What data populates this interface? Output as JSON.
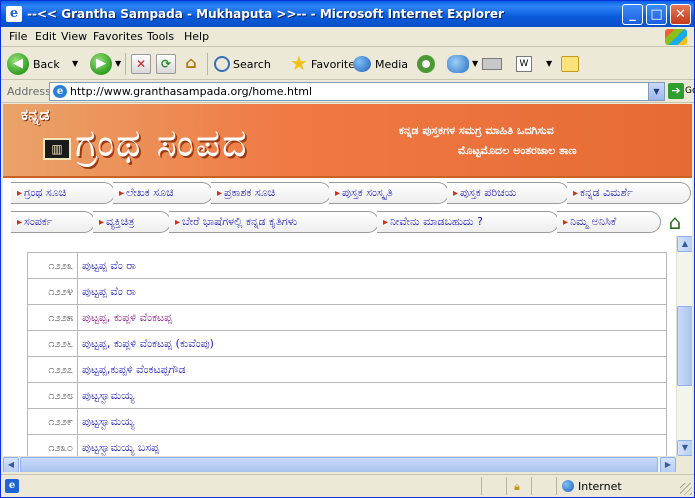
{
  "window": {
    "title": "--<< Grantha Sampada - Mukhaputa >>-- - Microsoft Internet Explorer",
    "min_glyph": "_",
    "max_glyph": "□",
    "close_glyph": "✕"
  },
  "menu": {
    "file": "File",
    "edit": "Edit",
    "view": "View",
    "favorites": "Favorites",
    "tools": "Tools",
    "help": "Help"
  },
  "toolbar": {
    "back": "Back",
    "search": "Search",
    "favorites": "Favorites",
    "media": "Media"
  },
  "address": {
    "label": "Address",
    "url": "http://www.granthasampada.org/home.html",
    "go": "Go"
  },
  "banner": {
    "kannada": "ಕನ್ನಡ",
    "title": "ಗ್ರಂಥ ಸಂಪದ",
    "subtitle_line1": "ಕನ್ನಡ ಪುಸ್ತಕಗಳ ಸಮಗ್ರ ಮಾಹಿತಿ ಒದಗಿಸುವ",
    "subtitle_line2": "ಮೊಟ್ಟಮೊದಲ ಅಂತರಜಾಲ ತಾಣ"
  },
  "nav": {
    "row1": [
      "ಗ್ರಂಥ ಸೂಚಿ",
      "ಲೇಖಕ ಸೂಚಿ",
      "ಪ್ರಕಾಶಕ ಸೂಚಿ",
      "ಪುಸ್ತಕ ಸಂಸ್ಕೃತಿ",
      "ಪುಸ್ತಕ ಪರಿಚಯ",
      "ಕನ್ನಡ ವಿಮರ್ಶೆ"
    ],
    "row2": [
      "ಸಂಪರ್ಕ",
      "ವ್ಯಕ್ತಿಚಿತ್ರ",
      "ಬೇರೆ ಭಾಷೆಗಳಲ್ಲಿ ಕನ್ನಡ ಕೃತಿಗಳು",
      "ನೀವೇನು ಮಾಡಬಹುದು ?",
      "ನಿಮ್ಮ ಅನಿಸಿಕೆ"
    ]
  },
  "table": {
    "rows": [
      {
        "num": "೧೨೨೩",
        "name": "ಪುಟ್ಟಪ್ಪ ವೆಂ ರಾ",
        "highlight": false
      },
      {
        "num": "೧೨೨೪",
        "name": "ಪುಟ್ಟಪ್ಪ ವೆಂ ರಾ",
        "highlight": false
      },
      {
        "num": "೧೨೨೫",
        "name": "ಪುಟ್ಟಪ್ಪ, ಕುಪ್ಪಳಿ ವೆಂಕಟಪ್ಪ",
        "highlight": true
      },
      {
        "num": "೧೨೨೬",
        "name": "ಪುಟ್ಟಪ್ಪ, ಕುಪ್ಪಳಿ ವೆಂಕಟಪ್ಪ (ಕುವೆಂಪು)",
        "highlight": false
      },
      {
        "num": "೧೨೨೭",
        "name": "ಪುಟ್ಟಪ್ಪ,ಕುಪ್ಪಳಿ ವೆಂಕಟಪ್ಪಗೌಡ",
        "highlight": false
      },
      {
        "num": "೧೨೨೮",
        "name": "ಪುಟ್ಟಸ್ವಾಮಯ್ಯ",
        "highlight": false
      },
      {
        "num": "೧೨೨೯",
        "name": "ಪುಟ್ಟಸ್ವಾಮಯ್ಯ",
        "highlight": false
      },
      {
        "num": "೧೨೩೦",
        "name": "ಪುಟ್ಟಸ್ವಾಮಯ್ಯ ಬಸಪ್ಪ",
        "highlight": false
      }
    ]
  },
  "status": {
    "zone": "Internet"
  },
  "icons": [
    "ie-icon",
    "back-icon",
    "forward-icon",
    "stop-icon",
    "refresh-icon",
    "home-icon",
    "search-icon",
    "favorites-icon",
    "media-icon",
    "history-icon",
    "mail-icon",
    "print-icon",
    "edit-icon",
    "messenger-icon",
    "page-icon",
    "go-icon",
    "house-icon",
    "lock-icon",
    "internet-zone-icon"
  ],
  "colors": {
    "titlebar": "#0A5FE6",
    "banner": "#F07A44",
    "link": "#1A1AB8",
    "bullet": "#D2301A",
    "visited": "#8A1A8A"
  }
}
